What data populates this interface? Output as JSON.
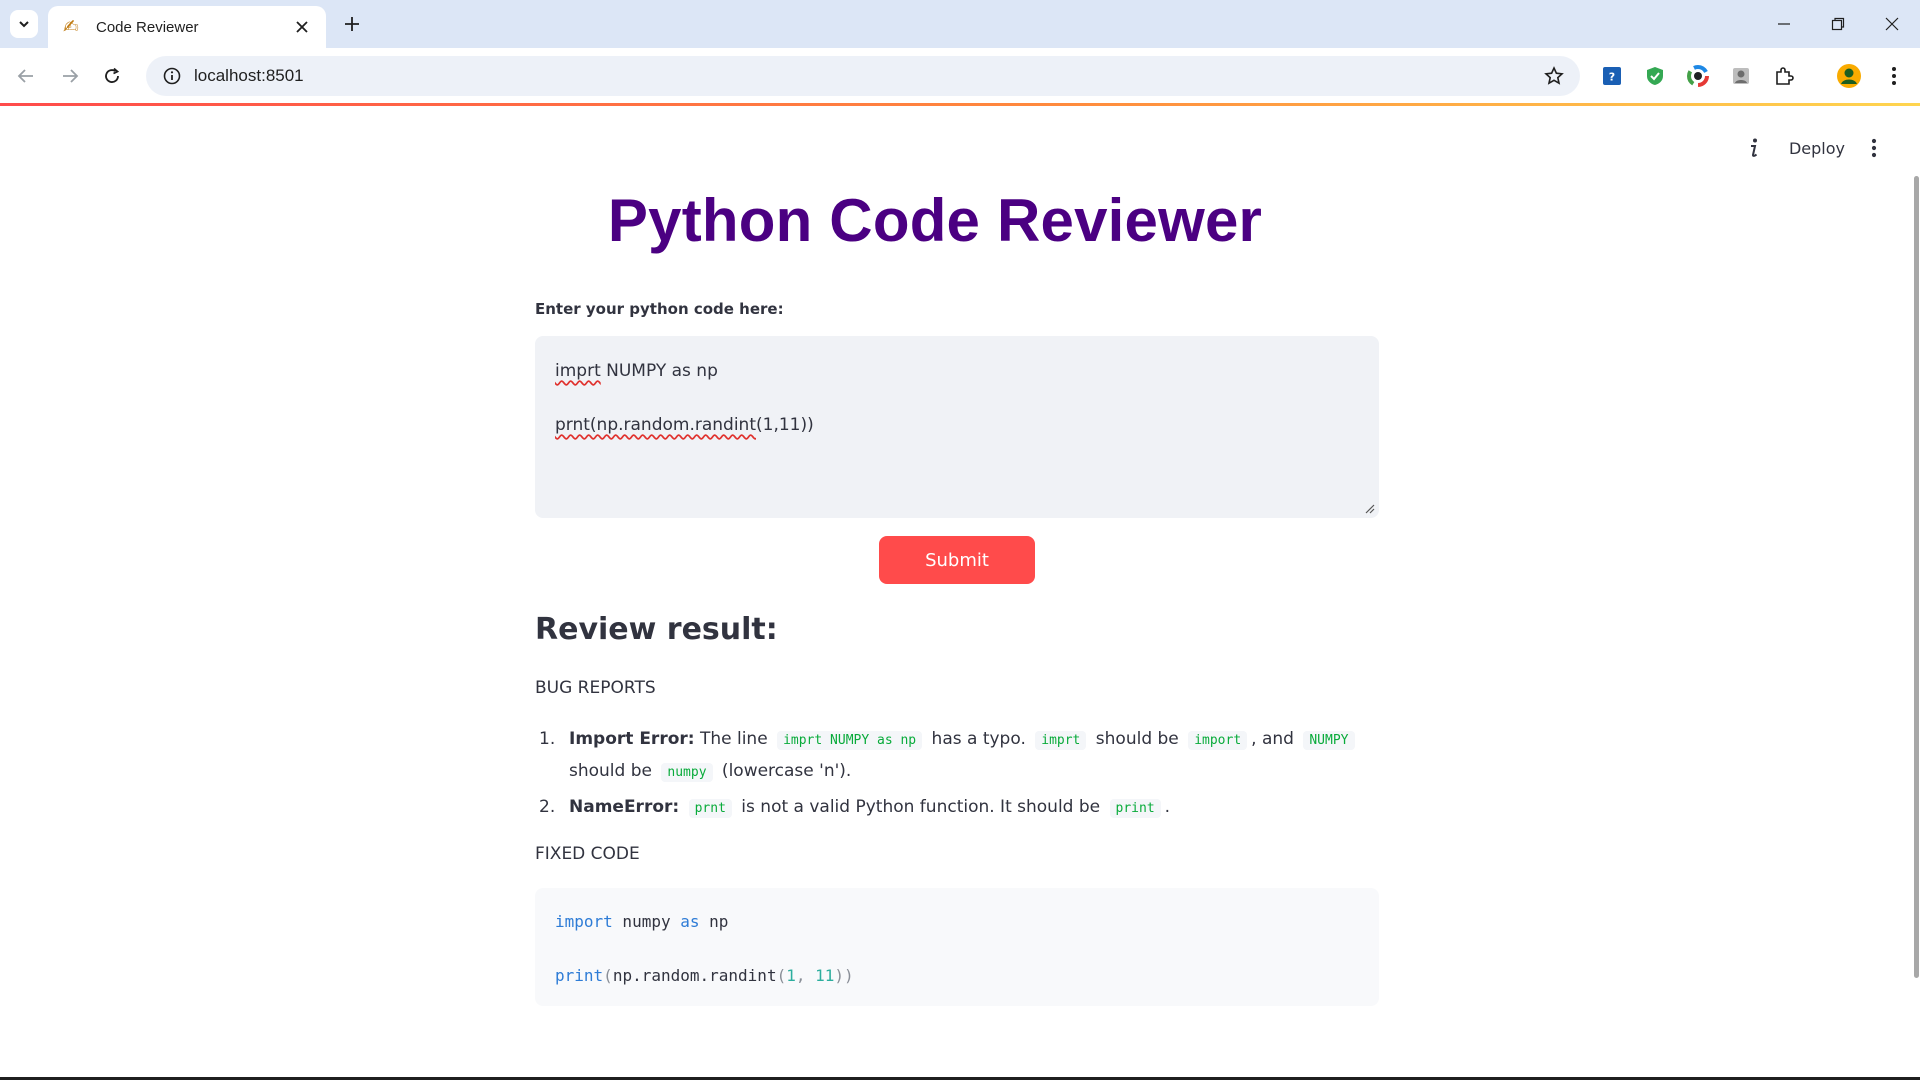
{
  "browser": {
    "tab_title": "Code Reviewer",
    "url": "localhost:8501"
  },
  "app": {
    "deploy_label": "Deploy",
    "title": "Python Code Reviewer",
    "input": {
      "label": "Enter your python code here:",
      "line1_bad": "imprt",
      "line1_rest": " NUMPY as np",
      "line2_bad": "prnt(np.random.randint",
      "line2_rest": "(1,11))"
    },
    "submit_label": "Submit",
    "review": {
      "heading": "Review result:",
      "bug_heading": "BUG REPORTS",
      "items": [
        {
          "num": "1.",
          "title": "Import Error:",
          "t1": " The line ",
          "c1": "imprt NUMPY as np",
          "t2": " has a typo. ",
          "c2": "imprt",
          "t3": " should be ",
          "c3": "import",
          "t4": ", and ",
          "c4": "NUMPY",
          "t5": " should be ",
          "c5": "numpy",
          "t6": " (lowercase 'n')."
        },
        {
          "num": "2.",
          "title": "NameError:",
          "t1": " ",
          "c1": "prnt",
          "t2": " is not a valid Python function. It should be ",
          "c2": "print",
          "t3": "."
        }
      ],
      "fixed_heading": "FIXED CODE",
      "fixed_code": {
        "l1_kw": "import",
        "l1_mid": " numpy ",
        "l1_as": "as",
        "l1_end": " np",
        "l2_fn": "print",
        "l2_open": "(",
        "l2_mid": "np.random.randint",
        "l2_open2": "(",
        "l2_n1": "1",
        "l2_sep": ", ",
        "l2_n2": "11",
        "l2_close": "))"
      }
    }
  },
  "colors": {
    "title": "#4b0082",
    "submit_bg": "#ff4b4b",
    "inline_code": "#09ab3b",
    "keyword": "#2e7cd6"
  }
}
